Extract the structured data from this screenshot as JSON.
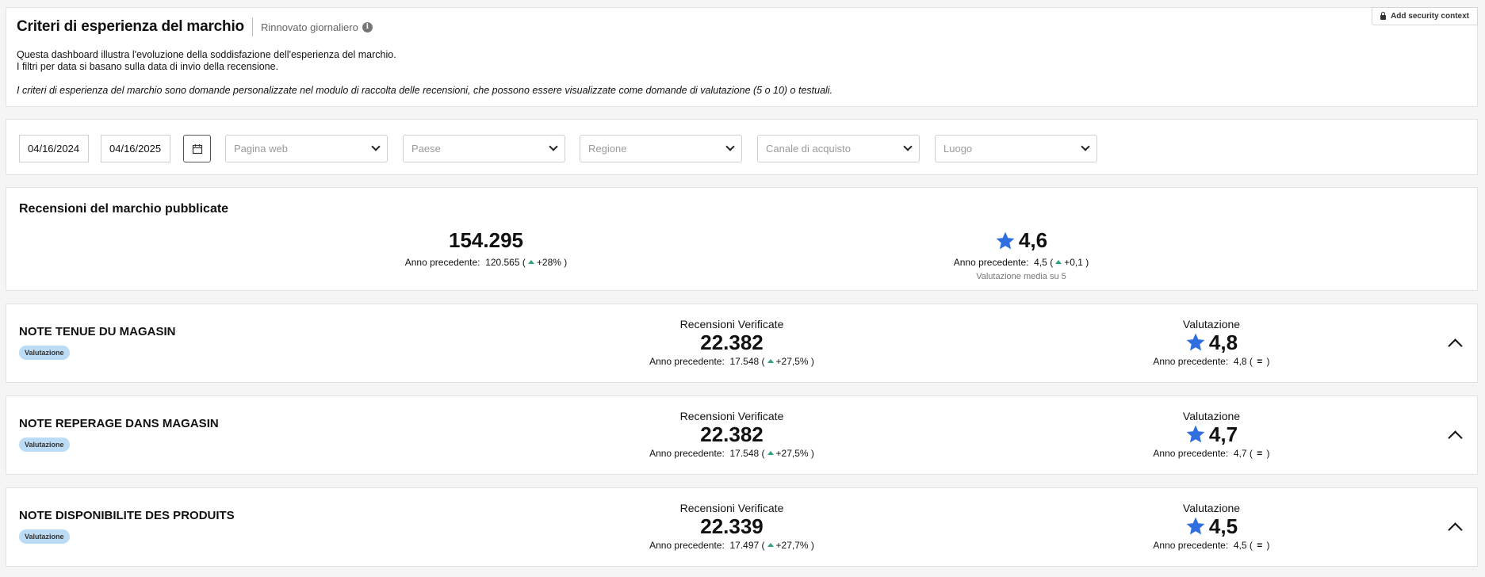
{
  "header": {
    "title": "Criteri di esperienza del marchio",
    "subtitle": "Rinnovato giornaliero",
    "info_icon": "i",
    "security_button": "Add security context",
    "desc_line1": "Questa dashboard illustra l'evoluzione della soddisfazione dell'esperienza del marchio.",
    "desc_line2": "I filtri per data si basano sulla data di invio della recensione.",
    "desc_italic": "I criteri di esperienza del marchio sono domande personalizzate nel modulo di raccolta delle recensioni, che possono essere visualizzate come domande di valutazione (5 o 10) o testuali."
  },
  "filters": {
    "start_date": "04/16/2024",
    "end_date": "04/16/2025",
    "selects": [
      "Pagina web",
      "Paese",
      "Regione",
      "Canale di acquisto",
      "Luogo"
    ]
  },
  "summary": {
    "title": "Recensioni del marchio pubblicate",
    "reviews": {
      "value": "154.295",
      "prev_label": "Anno precedente:",
      "prev_value": "120.565",
      "change": "+28%"
    },
    "rating": {
      "value": "4,6",
      "prev_label": "Anno precedente:",
      "prev_value": "4,5",
      "change": "+0,1",
      "note": "Valutazione media su 5"
    }
  },
  "criteria": [
    {
      "name": "NOTE TENUE DU MAGASIN",
      "badge": "Valutazione",
      "reviews_label": "Recensioni Verificate",
      "reviews_value": "22.382",
      "reviews_prev_label": "Anno precedente:",
      "reviews_prev": "17.548",
      "reviews_change": "+27,5%",
      "rating_label": "Valutazione",
      "rating_value": "4,8",
      "rating_prev_label": "Anno precedente:",
      "rating_prev": "4,8",
      "rating_change": "="
    },
    {
      "name": "NOTE REPERAGE DANS MAGASIN",
      "badge": "Valutazione",
      "reviews_label": "Recensioni Verificate",
      "reviews_value": "22.382",
      "reviews_prev_label": "Anno precedente:",
      "reviews_prev": "17.548",
      "reviews_change": "+27,5%",
      "rating_label": "Valutazione",
      "rating_value": "4,7",
      "rating_prev_label": "Anno precedente:",
      "rating_prev": "4,7",
      "rating_change": "="
    },
    {
      "name": "NOTE DISPONIBILITE DES PRODUITS",
      "badge": "Valutazione",
      "reviews_label": "Recensioni Verificate",
      "reviews_value": "22.339",
      "reviews_prev_label": "Anno precedente:",
      "reviews_prev": "17.497",
      "reviews_change": "+27,7%",
      "rating_label": "Valutazione",
      "rating_value": "4,5",
      "rating_prev_label": "Anno precedente:",
      "rating_prev": "4,5",
      "rating_change": "="
    }
  ],
  "colors": {
    "star": "#2f6fe0",
    "up_arrow": "#2ea37a",
    "badge_bg": "#bcdcf5"
  },
  "icons": [
    "info-icon",
    "lock-icon",
    "calendar-icon",
    "chevron-down-icon",
    "star-icon",
    "trend-up-icon",
    "chevron-up-icon"
  ]
}
